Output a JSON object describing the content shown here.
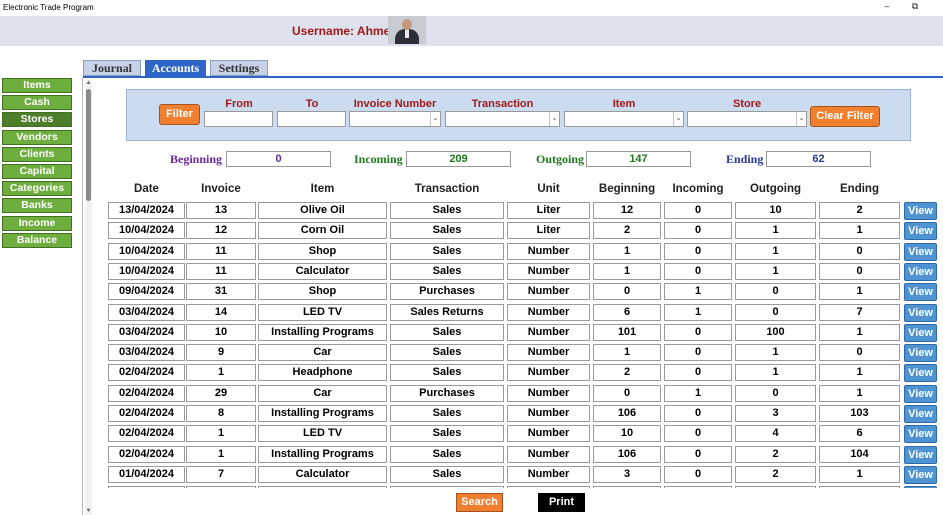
{
  "window": {
    "title": "Electronic Trade Program",
    "minimize_glyph": "–",
    "maximize_glyph": "⧉"
  },
  "header": {
    "username": "Username: Ahmed"
  },
  "sidebar": {
    "items": [
      {
        "label": "Items"
      },
      {
        "label": "Cash"
      },
      {
        "label": "Stores"
      },
      {
        "label": "Vendors"
      },
      {
        "label": "Clients"
      },
      {
        "label": "Capital"
      },
      {
        "label": "Categories"
      },
      {
        "label": "Banks"
      },
      {
        "label": "Income"
      },
      {
        "label": "Balance"
      }
    ],
    "active_index": 2
  },
  "tabs": [
    {
      "label": "Journal"
    },
    {
      "label": "Accounts"
    },
    {
      "label": "Settings"
    }
  ],
  "filter": {
    "filter_label": "Filter",
    "clear_label": "Clear Filter",
    "labels": {
      "from": "From",
      "to": "To",
      "invoice": "Invoice Number",
      "transaction": "Transaction",
      "item": "Item",
      "store": "Store"
    },
    "dropdown_glyph": "⌄"
  },
  "summary": {
    "beginning": {
      "label": "Beginning",
      "value": "0",
      "color": "#6a2a9a"
    },
    "incoming": {
      "label": "Incoming",
      "value": "209",
      "color": "#1e7a1e"
    },
    "outgoing": {
      "label": "Outgoing",
      "value": "147",
      "color": "#1e7a1e"
    },
    "ending": {
      "label": "Ending",
      "value": "62",
      "color": "#2a3a9a"
    }
  },
  "table": {
    "columns": [
      "Date",
      "Invoice",
      "Item",
      "Transaction",
      "Unit",
      "Beginning",
      "Incoming",
      "Outgoing",
      "Ending"
    ],
    "view_label": "View",
    "rows": [
      [
        "13/04/2024",
        "13",
        "Olive Oil",
        "Sales",
        "Liter",
        "12",
        "0",
        "10",
        "2"
      ],
      [
        "10/04/2024",
        "12",
        "Corn Oil",
        "Sales",
        "Liter",
        "2",
        "0",
        "1",
        "1"
      ],
      [
        "10/04/2024",
        "11",
        "Shop",
        "Sales",
        "Number",
        "1",
        "0",
        "1",
        "0"
      ],
      [
        "10/04/2024",
        "11",
        "Calculator",
        "Sales",
        "Number",
        "1",
        "0",
        "1",
        "0"
      ],
      [
        "09/04/2024",
        "31",
        "Shop",
        "Purchases",
        "Number",
        "0",
        "1",
        "0",
        "1"
      ],
      [
        "03/04/2024",
        "14",
        "LED TV",
        "Sales Returns",
        "Number",
        "6",
        "1",
        "0",
        "7"
      ],
      [
        "03/04/2024",
        "10",
        "Installing Programs",
        "Sales",
        "Number",
        "101",
        "0",
        "100",
        "1"
      ],
      [
        "03/04/2024",
        "9",
        "Car",
        "Sales",
        "Number",
        "1",
        "0",
        "1",
        "0"
      ],
      [
        "02/04/2024",
        "1",
        "Headphone",
        "Sales",
        "Number",
        "2",
        "0",
        "1",
        "1"
      ],
      [
        "02/04/2024",
        "29",
        "Car",
        "Purchases",
        "Number",
        "0",
        "1",
        "0",
        "1"
      ],
      [
        "02/04/2024",
        "8",
        "Installing Programs",
        "Sales",
        "Number",
        "106",
        "0",
        "3",
        "103"
      ],
      [
        "02/04/2024",
        "1",
        "LED TV",
        "Sales",
        "Number",
        "10",
        "0",
        "4",
        "6"
      ],
      [
        "02/04/2024",
        "1",
        "Installing Programs",
        "Sales",
        "Number",
        "106",
        "0",
        "2",
        "104"
      ],
      [
        "01/04/2024",
        "7",
        "Calculator",
        "Sales",
        "Number",
        "3",
        "0",
        "2",
        "1"
      ]
    ]
  },
  "footer": {
    "search_label": "Search",
    "print_label": "Print"
  },
  "colors": {
    "accent": "#2e66c8",
    "sidebar_green": "#6eae3e",
    "orange": "#f0802f",
    "view_blue": "#4f93d3",
    "username_red": "#a01818"
  }
}
